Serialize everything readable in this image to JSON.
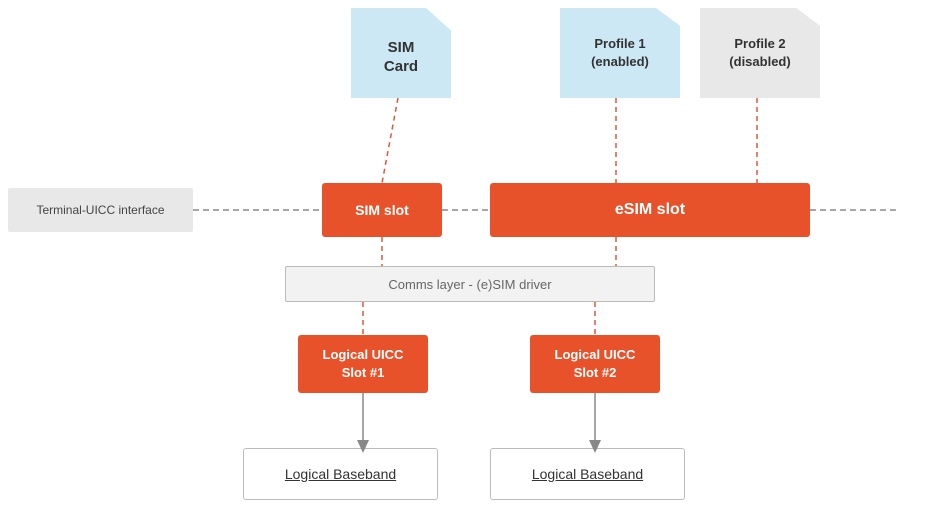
{
  "sim_card": {
    "label": "SIM\nCard"
  },
  "profile1": {
    "label": "Profile 1\n(enabled)"
  },
  "profile2": {
    "label": "Profile 2\n(disabled)"
  },
  "terminal": {
    "label": "Terminal-UICC interface"
  },
  "sim_slot": {
    "label": "SIM slot"
  },
  "esim_slot": {
    "label": "eSIM slot"
  },
  "comms_layer": {
    "label": "Comms layer - (e)SIM driver"
  },
  "logical1": {
    "label": "Logical UICC\nSlot #1"
  },
  "logical2": {
    "label": "Logical UICC\nSlot #2"
  },
  "baseband1": {
    "label": "Logical Baseband"
  },
  "baseband2": {
    "label": "Logical Baseband"
  }
}
